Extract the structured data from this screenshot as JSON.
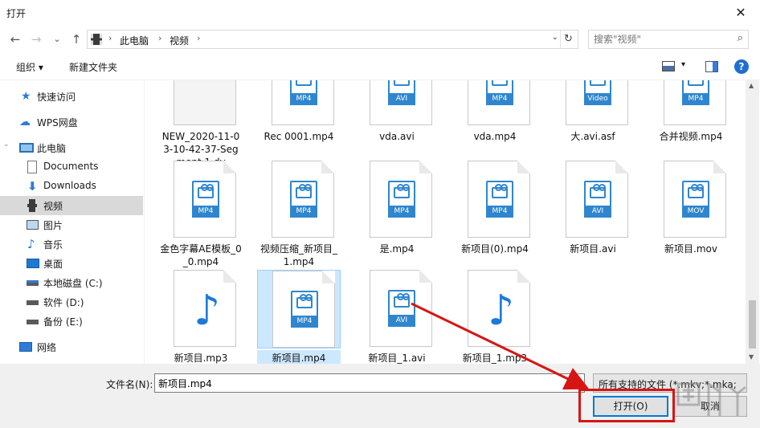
{
  "window": {
    "title": "打开",
    "close": "✕"
  },
  "nav": {
    "back": "←",
    "forward": "→",
    "recent": "⌄",
    "up": "↑"
  },
  "address": {
    "crumbs": [
      "此电脑",
      "视频"
    ],
    "sep": "›",
    "dropdown": "⌄",
    "refresh": "↻"
  },
  "search": {
    "placeholder": "搜索\"视频\"",
    "icon": "⌕"
  },
  "toolbar": {
    "organize": "组织 ▾",
    "new_folder": "新建文件夹",
    "help": "?",
    "view_dd": "▾"
  },
  "sidebar": {
    "items": [
      {
        "label": "快速访问",
        "icon": "star-icon"
      },
      {
        "label": "WPS网盘",
        "icon": "cloud-icon"
      },
      {
        "label": "此电脑",
        "icon": "computer-icon"
      },
      {
        "label": "Documents",
        "icon": "document-icon"
      },
      {
        "label": "Downloads",
        "icon": "download-icon"
      },
      {
        "label": "视频",
        "icon": "video-folder-icon"
      },
      {
        "label": "图片",
        "icon": "picture-icon"
      },
      {
        "label": "音乐",
        "icon": "music-icon"
      },
      {
        "label": "桌面",
        "icon": "desktop-icon"
      },
      {
        "label": "本地磁盘 (C:)",
        "icon": "drive-icon"
      },
      {
        "label": "软件 (D:)",
        "icon": "drive-icon"
      },
      {
        "label": "备份 (E:)",
        "icon": "drive-icon"
      },
      {
        "label": "网络",
        "icon": "network-icon"
      }
    ]
  },
  "files": [
    {
      "name": "NEW_2020-11-03-10-42-37-Segment 1.dv",
      "kind": "blank",
      "tag": ""
    },
    {
      "name": "Rec 0001.mp4",
      "kind": "video",
      "tag": "MP4"
    },
    {
      "name": "vda.avi",
      "kind": "video",
      "tag": "AVI"
    },
    {
      "name": "vda.mp4",
      "kind": "video",
      "tag": "MP4"
    },
    {
      "name": "大.avi.asf",
      "kind": "video",
      "tag": "Video"
    },
    {
      "name": "合并视频.mp4",
      "kind": "video",
      "tag": "MP4"
    },
    {
      "name": "金色字幕AE模板_0_0.mp4",
      "kind": "video",
      "tag": "MP4"
    },
    {
      "name": "视频压缩_新项目_1.mp4",
      "kind": "video",
      "tag": "MP4"
    },
    {
      "name": "是.mp4",
      "kind": "video",
      "tag": "MP4"
    },
    {
      "name": "新项目(0).mp4",
      "kind": "video",
      "tag": "MP4"
    },
    {
      "name": "新项目.avi",
      "kind": "video",
      "tag": "AVI"
    },
    {
      "name": "新项目.mov",
      "kind": "video",
      "tag": "MOV"
    },
    {
      "name": "新项目.mp3",
      "kind": "audio",
      "tag": ""
    },
    {
      "name": "新项目.mp4",
      "kind": "video",
      "tag": "MP4",
      "selected": true
    },
    {
      "name": "新项目_1.avi",
      "kind": "video",
      "tag": "AVI"
    },
    {
      "name": "新项目_1.mp3",
      "kind": "audio",
      "tag": ""
    }
  ],
  "footer": {
    "filename_label": "文件名(N):",
    "filename_value": "新项目.mp4",
    "filetype": "所有支持的文件 (*.mkv;*.mka;",
    "open": "打开(O)",
    "cancel": "取消"
  },
  "colors": {
    "accent": "#2f86cf",
    "highlight": "#d71515",
    "selected": "#cce8ff"
  }
}
